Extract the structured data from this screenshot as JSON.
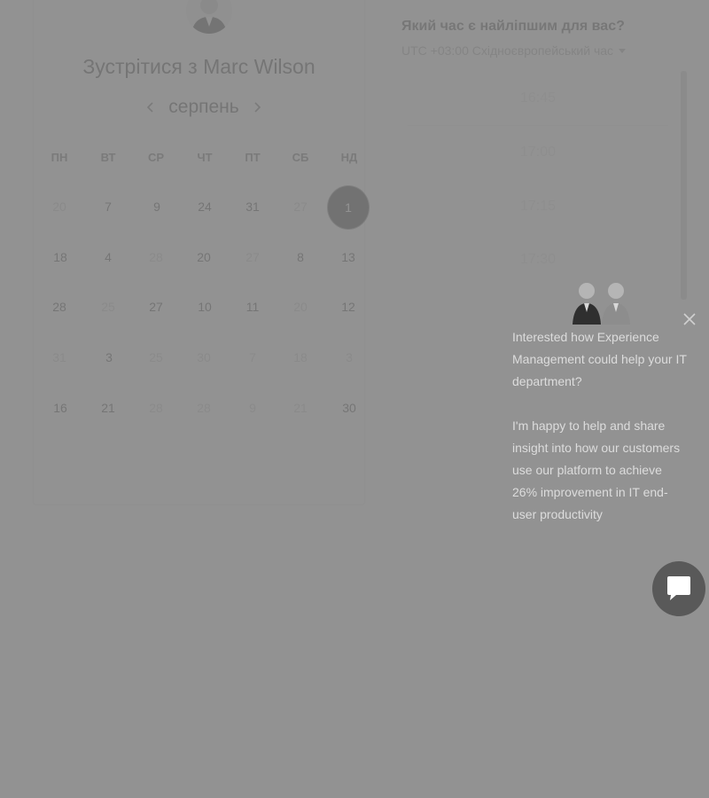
{
  "scheduler": {
    "title": "Зустрітися з Marc Wilson",
    "month": "серпень",
    "weekdays": [
      "ПН",
      "ВТ",
      "СР",
      "ЧТ",
      "ПТ",
      "СБ",
      "НД"
    ],
    "days": [
      [
        "20",
        "7",
        "9",
        "24",
        "31",
        "27",
        "1"
      ],
      [
        "18",
        "4",
        "28",
        "20",
        "27",
        "8",
        "13"
      ],
      [
        "28",
        "25",
        "27",
        "10",
        "11",
        "20",
        "12"
      ],
      [
        "31",
        "3",
        "25",
        "30",
        "7",
        "18",
        "3"
      ],
      [
        "16",
        "21",
        "28",
        "28",
        "9",
        "21",
        "30"
      ]
    ],
    "selected_day": "1"
  },
  "time_picker": {
    "title": "Який час є найліпшим для вас?",
    "timezone": "UTC +03:00 Східноєвропейський час",
    "slots": [
      "16:45",
      "17:00",
      "17:15",
      "17:30"
    ]
  },
  "chat_popup": {
    "message_1": "Interested how Experience Management could help your IT department?",
    "message_2": "I'm happy to help and share insight into how our customers use our platform to achieve 26% improvement in IT end-user productivity"
  }
}
